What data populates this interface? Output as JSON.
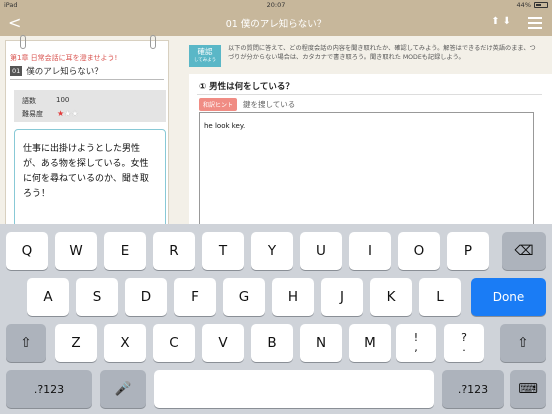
{
  "status_bar": {
    "device": "iPad",
    "time": "20:07",
    "battery": "44%"
  },
  "nav": {
    "back_icon": "<",
    "title": "01 僕のアレ知らない？",
    "arrows": "⬆⬇"
  },
  "notebook": {
    "chapter": "第1章 日常会話に耳を澄ませよう!",
    "lesson_number": "01",
    "lesson_title": "僕のアレ知らない？",
    "word_count_label": "語数",
    "word_count_value": "100",
    "difficulty_label": "難易度",
    "difficulty_stars": 1,
    "difficulty_max": 3,
    "prompt_text": "仕事に出掛けようとした男性が、ある物を探している。女性に何を尋ねているのか、聞き取ろう！"
  },
  "right": {
    "confirm_label": "確認",
    "confirm_sub": "してみよう",
    "description": "以下の質問に答えて、どの程度会話の内容を聞き取れたか、確認してみよう。解答はできるだけ英語のまま、つづりが分からない場合は、カタカナで書き取ろう。聞き取れた MODEも記録しよう。",
    "question": "① 男性は何をしている？",
    "hint_tag": "和訳ヒント",
    "hint_text": "鍵を捜している",
    "answer_text": "he look key."
  },
  "keyboard": {
    "row1": [
      "Q",
      "W",
      "E",
      "R",
      "T",
      "Y",
      "U",
      "I",
      "O",
      "P"
    ],
    "row2": [
      "A",
      "S",
      "D",
      "F",
      "G",
      "H",
      "J",
      "K",
      "L"
    ],
    "row3": [
      "Z",
      "X",
      "C",
      "V",
      "B",
      "N",
      "M"
    ],
    "punct1": [
      "!",
      ","
    ],
    "punct2": [
      "?",
      "."
    ],
    "done_label": "Done",
    "numbers_label": ".?123",
    "numbers_label_right": ".?123",
    "shift_icon": "⇧",
    "delete_icon": "⌫",
    "mic_icon": "🎤",
    "hide_keyboard_icon": "⌨"
  },
  "colors": {
    "nav": "#c7b79b",
    "accent": "#5ab7c7",
    "done": "#1a7cf5",
    "chapter": "#d9534f"
  }
}
